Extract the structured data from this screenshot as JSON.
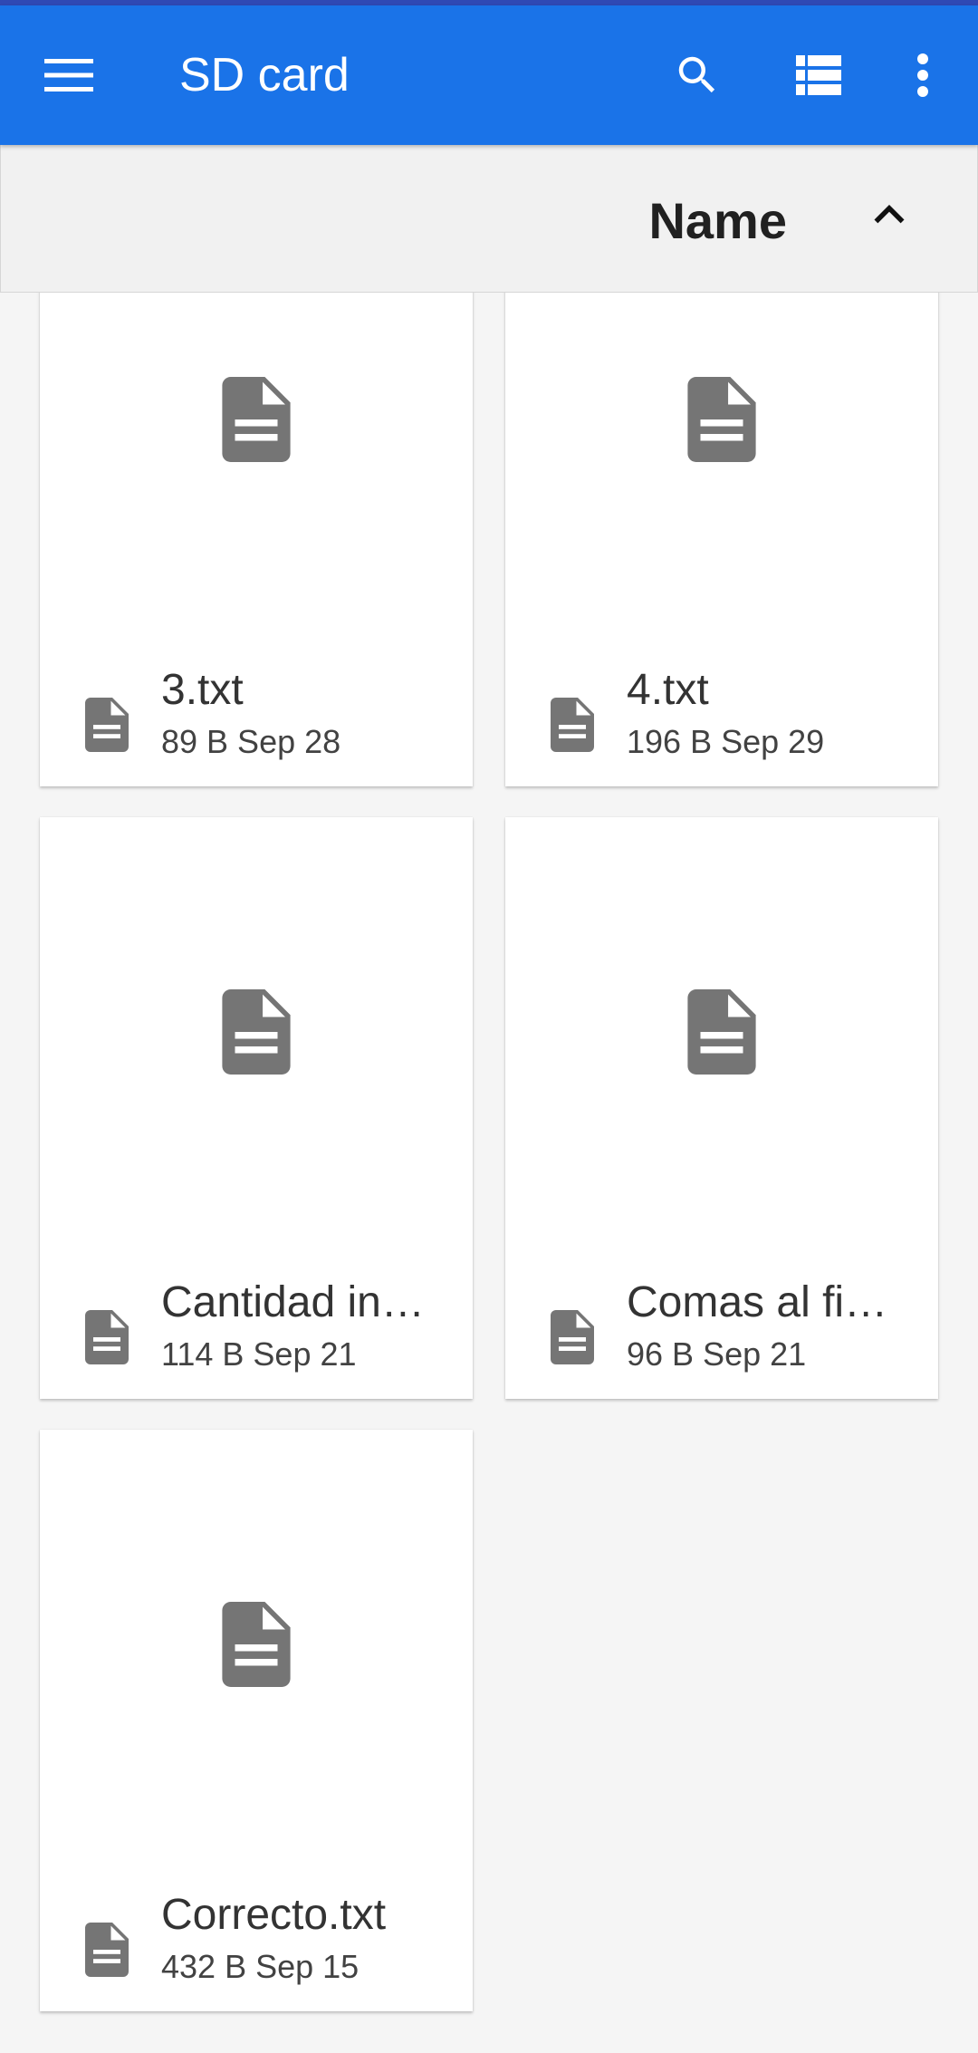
{
  "toolbar": {
    "title": "SD card",
    "menu_icon": "hamburger-menu-icon",
    "search_icon": "search-icon",
    "view_icon": "list-view-icon",
    "overflow_icon": "more-vert-icon",
    "background": "#1a73e8"
  },
  "sort": {
    "label": "Name",
    "direction_icon": "chevron-up-icon"
  },
  "files": [
    {
      "name": "3.txt",
      "meta": "89 B Sep 28",
      "icon": "text-file-icon"
    },
    {
      "name": "4.txt",
      "meta": "196 B Sep 29",
      "icon": "text-file-icon"
    },
    {
      "name": "Cantidad in…",
      "meta": "114 B Sep 21",
      "icon": "text-file-icon"
    },
    {
      "name": "Comas al fi…",
      "meta": "96 B Sep 21",
      "icon": "text-file-icon"
    },
    {
      "name": "Correcto.txt",
      "meta": "432 B Sep 15",
      "icon": "text-file-icon"
    }
  ],
  "colors": {
    "icon_gray": "#757575",
    "background": "#f5f5f5"
  }
}
